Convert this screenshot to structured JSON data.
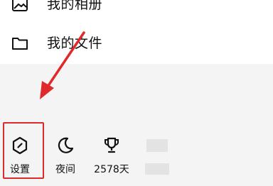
{
  "menu": {
    "items": [
      {
        "label": "我的相册",
        "icon": "image-icon"
      },
      {
        "label": "我的文件",
        "icon": "folder-icon"
      }
    ]
  },
  "toolbar": {
    "items": [
      {
        "label": "设置",
        "icon": "settings-hexagon-icon"
      },
      {
        "label": "夜间",
        "icon": "moon-icon"
      },
      {
        "label": "2578天",
        "icon": "trophy-icon"
      }
    ]
  },
  "annotations": {
    "highlight_color": "#e0292b",
    "arrow_color": "#e0292b"
  }
}
